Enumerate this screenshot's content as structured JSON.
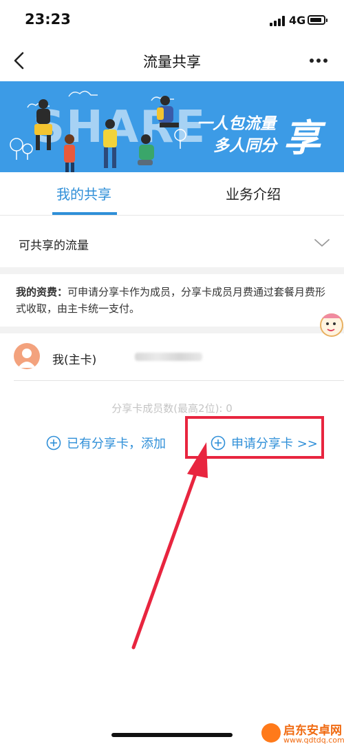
{
  "status_bar": {
    "time": "23:23",
    "network": "4G"
  },
  "nav": {
    "title": "流量共享",
    "back_icon": "chevron-left-icon",
    "more_icon": "ellipsis-icon"
  },
  "banner": {
    "bg_text": "SHARE",
    "slogan_line1": "一人包流量",
    "slogan_line2": "多人同分",
    "slogan_big": "享",
    "background": "#3c9be6"
  },
  "tabs": [
    {
      "label": "我的共享",
      "active": true
    },
    {
      "label": "业务介绍",
      "active": false
    }
  ],
  "flow": {
    "label": "可共享的流量",
    "chevron_icon": "chevron-down-icon"
  },
  "fee": {
    "title": "我的资费：",
    "text": "可申请分享卡作为成员，分享卡成员月费通过套餐月费形式收取，由主卡统一支付。"
  },
  "me": {
    "label": "我(主卡)"
  },
  "members": {
    "count_text": "分享卡成员数(最高2位): 0"
  },
  "actions": {
    "add_existing": "已有分享卡，添加",
    "apply": "申请分享卡 >>"
  },
  "watermark": {
    "name": "启东安卓网",
    "url": "www.qdtdq.com"
  },
  "colors": {
    "accent": "#2f8fd8",
    "highlight": "#e8253f"
  }
}
